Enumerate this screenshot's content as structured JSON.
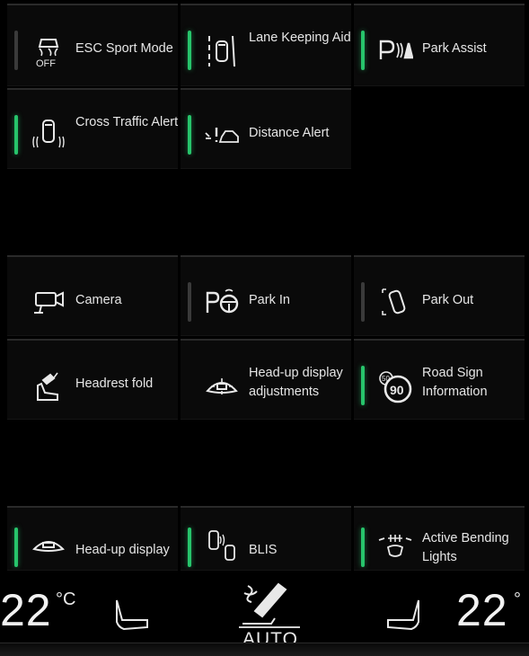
{
  "tiles": [
    {
      "label": "ESC Sport Mode",
      "icon": "esc-off-icon",
      "indicator": "off"
    },
    {
      "label": "Lane Keeping Aid",
      "icon": "lane-keeping-icon",
      "indicator": "on"
    },
    {
      "label": "Park Assist",
      "icon": "park-assist-icon",
      "indicator": "on"
    },
    {
      "label": "Cross Traffic Alert",
      "icon": "cross-traffic-icon",
      "indicator": "on"
    },
    {
      "label": "Distance Alert",
      "icon": "distance-alert-icon",
      "indicator": "on"
    },
    {
      "label": "Camera",
      "icon": "camera-icon",
      "indicator": "none"
    },
    {
      "label": "Park In",
      "icon": "park-in-icon",
      "indicator": "off"
    },
    {
      "label": "Park Out",
      "icon": "park-out-icon",
      "indicator": "off"
    },
    {
      "label": "Headrest fold",
      "icon": "headrest-fold-icon",
      "indicator": "none"
    },
    {
      "label": "Head-up display adjustments",
      "icon": "hud-adjust-icon",
      "indicator": "none"
    },
    {
      "label": "Road Sign Information",
      "icon": "road-sign-icon",
      "indicator": "on",
      "sign_text": "90",
      "sign_small": "50"
    },
    {
      "label": "Head-up display",
      "icon": "hud-icon",
      "indicator": "on"
    },
    {
      "label": "BLIS",
      "icon": "blis-icon",
      "indicator": "on"
    },
    {
      "label": "Active Bending Lights",
      "icon": "bending-lights-icon",
      "indicator": "on"
    }
  ],
  "climate": {
    "left_temp": "22",
    "left_unit": "°C",
    "right_temp": "22",
    "right_unit": "°",
    "fan_mode": "AUTO",
    "off_label": "OFF"
  },
  "colors": {
    "indicator_on": "#27c46b",
    "indicator_off": "#3a3a3a",
    "tile_bg": "#0a0a0a"
  }
}
